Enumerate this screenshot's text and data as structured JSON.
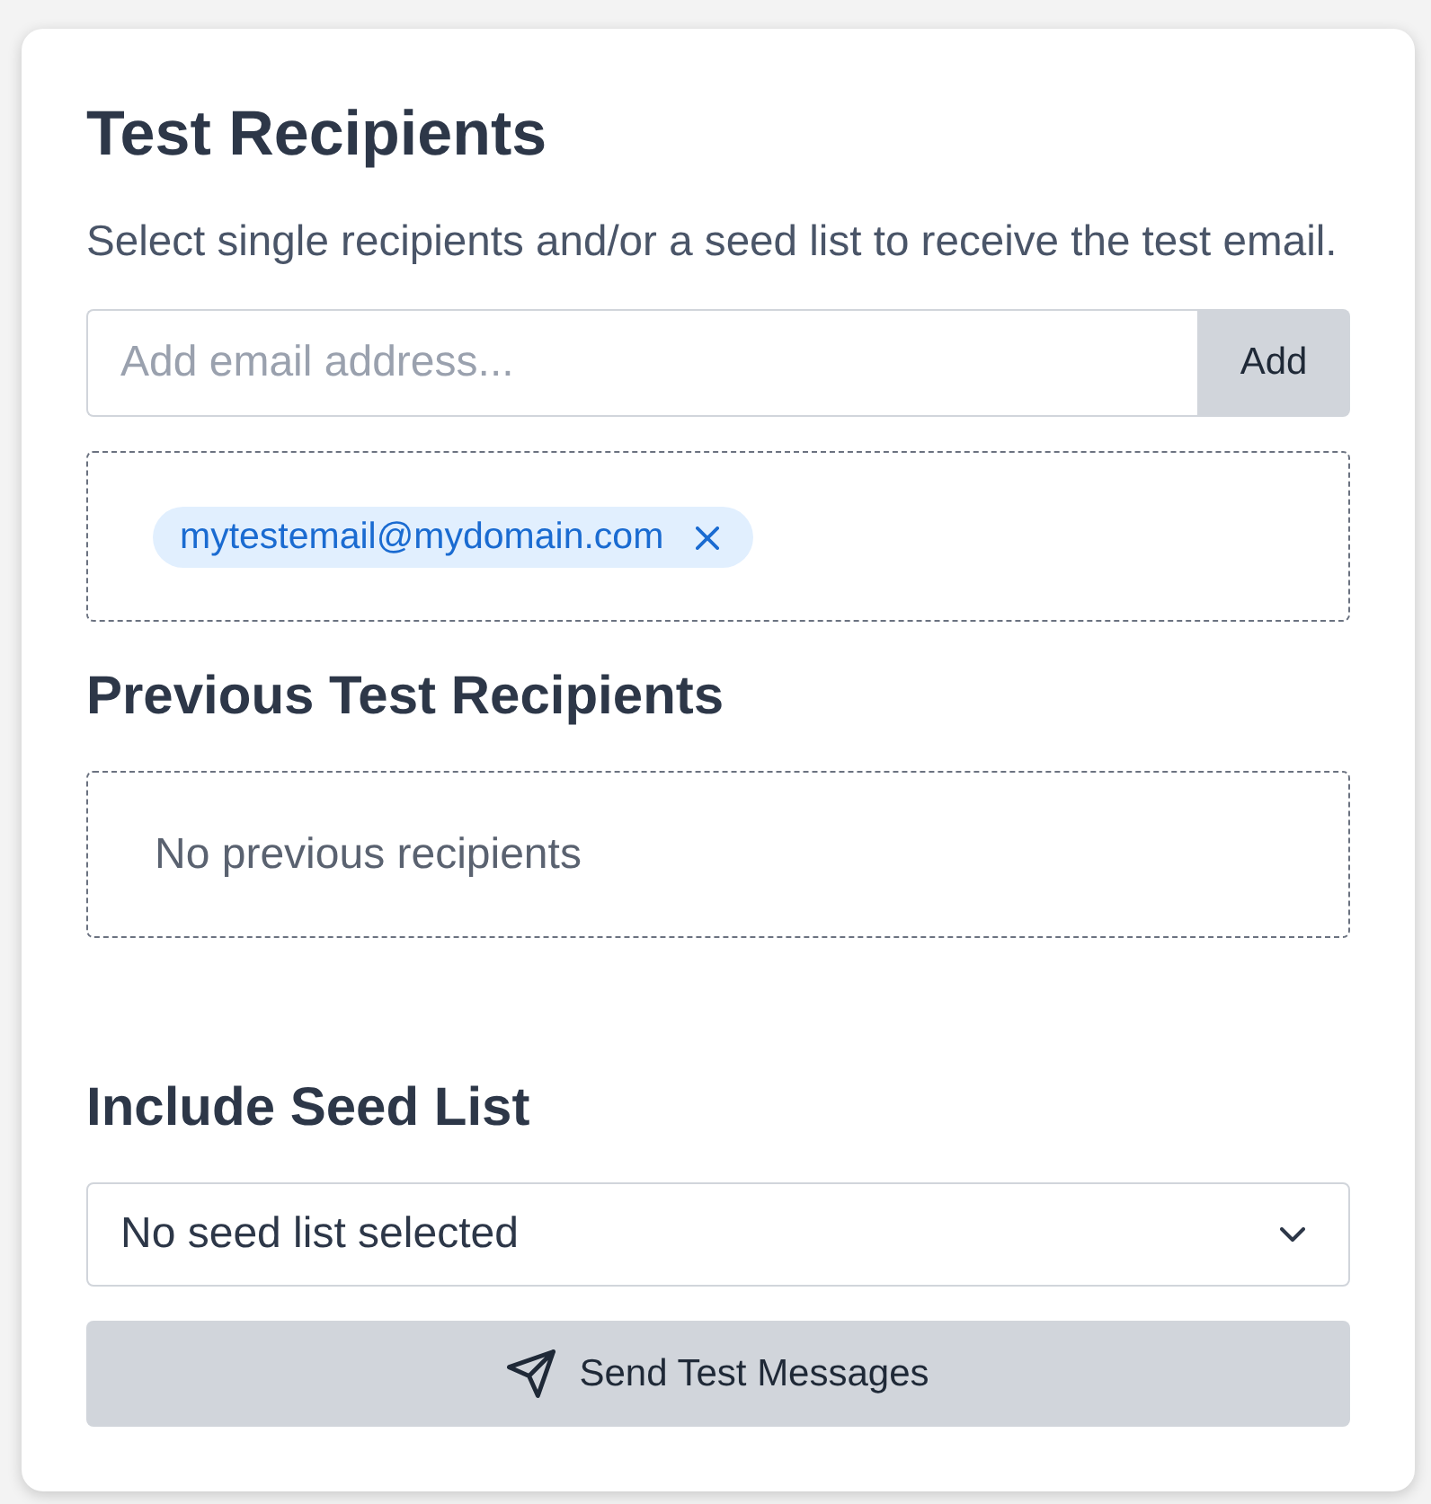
{
  "card": {
    "title": "Test Recipients",
    "description": "Select single recipients and/or a seed list to receive the test email.",
    "email_input": {
      "placeholder": "Add email address..."
    },
    "add_button": "Add",
    "recipients": [
      {
        "email": "mytestemail@mydomain.com"
      }
    ],
    "previous_heading": "Previous Test Recipients",
    "previous_empty": "No previous recipients",
    "seed_heading": "Include Seed List",
    "seed_select": {
      "value": "No seed list selected"
    },
    "send_button": "Send Test Messages"
  }
}
